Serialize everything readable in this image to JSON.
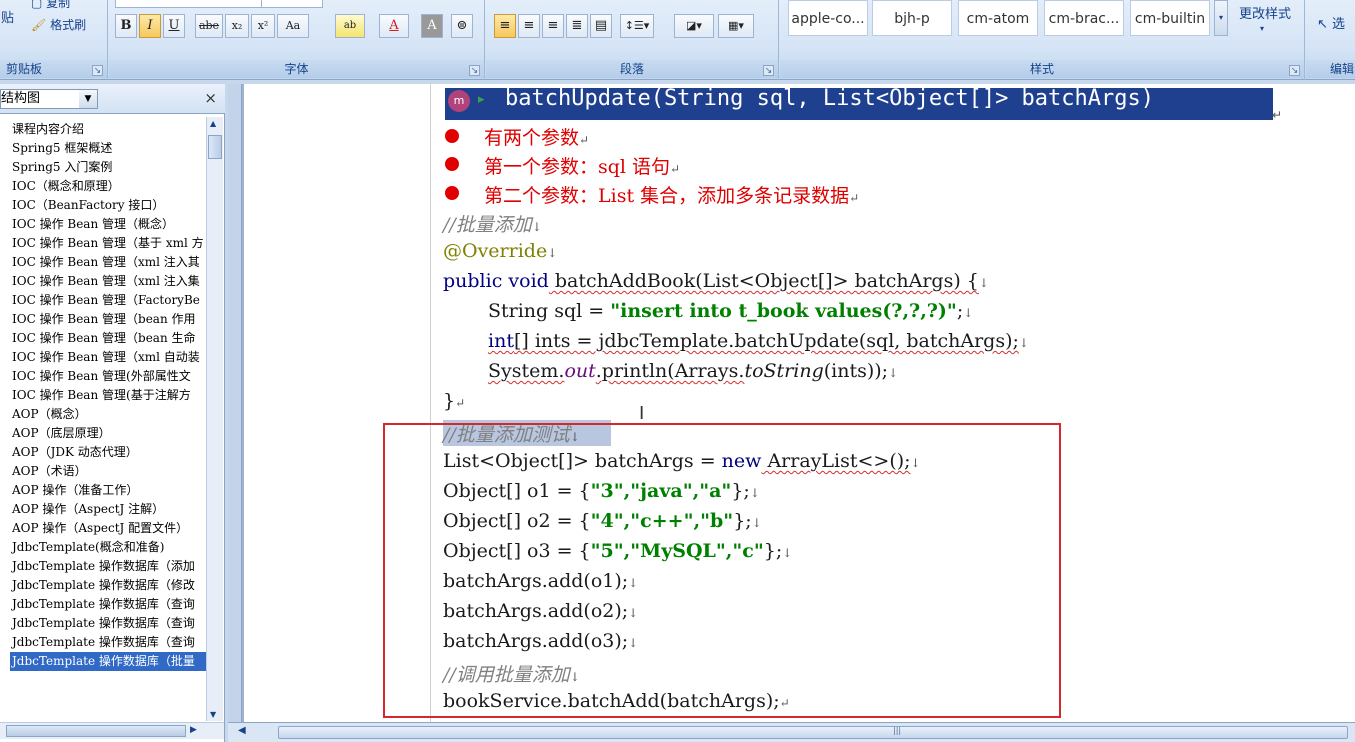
{
  "ribbon": {
    "clipboard": {
      "label": "剪贴板",
      "paste": "贴",
      "copy": "复制",
      "format_painter": "格式刷"
    },
    "font": {
      "label": "字体",
      "buttons": [
        "B",
        "I",
        "U",
        "abe",
        "x₂",
        "x²",
        "Aa",
        "ab",
        "A",
        "A",
        "⊜"
      ]
    },
    "paragraph": {
      "label": "段落"
    },
    "styles": {
      "label": "样式",
      "items": [
        "apple-co...",
        "bjh-p",
        "cm-atom",
        "cm-brac...",
        "cm-builtin"
      ],
      "change_styles": "更改样式"
    },
    "editing": {
      "label": "编辑",
      "select": "选"
    }
  },
  "nav": {
    "dropdown": "结构图",
    "close": "×",
    "items": [
      "课程内容介绍",
      "Spring5 框架概述",
      "Spring5 入门案例",
      "IOC（概念和原理）",
      "IOC（BeanFactory 接口）",
      "IOC 操作 Bean 管理（概念）",
      "IOC 操作 Bean 管理（基于 xml 方",
      "IOC 操作 Bean 管理（xml 注入其",
      "IOC 操作 Bean 管理（xml 注入集",
      "IOC 操作 Bean 管理（FactoryBe",
      "IOC 操作 Bean 管理（bean 作用",
      "IOC 操作 Bean 管理（bean 生命",
      "IOC 操作 Bean 管理（xml 自动装",
      "IOC 操作 Bean 管理(外部属性文",
      "IOC 操作 Bean 管理(基于注解方",
      "AOP（概念）",
      "AOP（底层原理）",
      "AOP（JDK 动态代理）",
      "AOP（术语）",
      "AOP 操作（准备工作）",
      "AOP 操作（AspectJ 注解）",
      "AOP 操作（AspectJ 配置文件）",
      "JdbcTemplate(概念和准备)",
      "JdbcTemplate 操作数据库（添加",
      "JdbcTemplate 操作数据库（修改",
      "JdbcTemplate 操作数据库（查询",
      "JdbcTemplate 操作数据库（查询",
      "JdbcTemplate 操作数据库（查询",
      "JdbcTemplate 操作数据库（批量"
    ],
    "selected_index": 28
  },
  "doc": {
    "heading": "batchUpdate(String sql, List<Object[]> batchArgs)",
    "bullets": [
      "有两个参数",
      "第一个参数：sql 语句",
      "第二个参数：List 集合，添加多条记录数据"
    ],
    "comment1": "//批量添加",
    "annotation": "@Override",
    "sig_kw": "public void",
    "sig_rest": " batchAddBook(List<Object[]> batchArgs) {",
    "line_sql_pre": "String sql = ",
    "line_sql_str": "\"insert into t_book values(?,?,?)\"",
    "line_sql_end": ";",
    "line_ints_kw": "int",
    "line_ints_rest": "[] ints = jdbcTemplate.batchUpdate(sql, batchArgs);",
    "line_print_pre": "System.",
    "line_print_out": "out",
    "line_print_mid": ".println(Arrays.",
    "line_print_ts": "toString",
    "line_print_end": "(ints));",
    "close_brace": "}",
    "comment2": "//批量添加测试",
    "list_line_pre": "List<Object[]> batchArgs = ",
    "list_line_kw": "new",
    "list_line_end": " ArrayList<>();",
    "o1_pre": "Object[] o1 = {",
    "o1_vals": "\"3\",\"java\",\"a\"",
    "o2_pre": "Object[] o2 = {",
    "o2_vals": "\"4\",\"c++\",\"b\"",
    "o3_pre": "Object[] o3 = {",
    "o3_vals": "\"5\",\"MySQL\",\"c\"",
    "obj_end": "};",
    "add1": "batchArgs.add(o1);",
    "add2": "batchArgs.add(o2);",
    "add3": "batchArgs.add(o3);",
    "comment3": "//调用批量添加",
    "call": "bookService.batchAdd(batchArgs);"
  },
  "colors": {
    "heading_bg": "#1f3f8f",
    "highlight_box": "#d4282c",
    "keyword": "#000080",
    "string": "#008000",
    "comment": "#808080",
    "bullet": "#e00000",
    "nav_selected": "#3169c6"
  }
}
